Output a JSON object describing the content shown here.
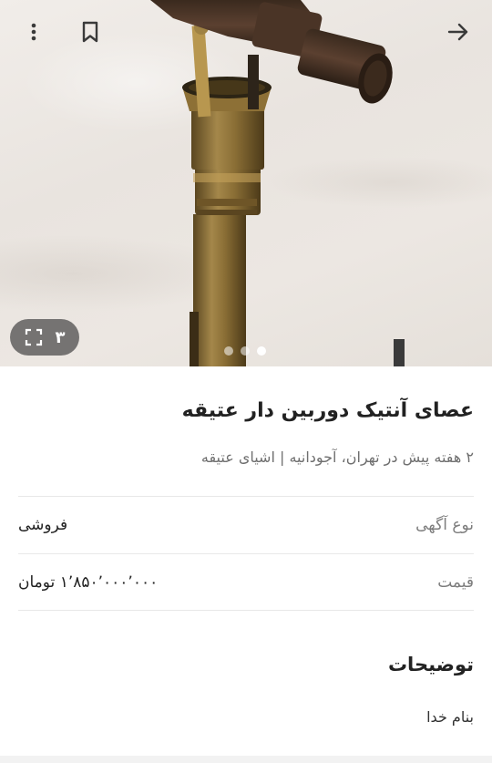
{
  "gallery": {
    "image_alt": "antique telescope cane photo",
    "count_label": "۳",
    "page_count": 3,
    "active_page": 3
  },
  "header_icons": {
    "more": "more-vertical-icon",
    "bookmark": "bookmark-icon",
    "forward": "arrow-right-icon",
    "expand": "expand-icon"
  },
  "ad": {
    "title": "عصای آنتیک دوربین دار عتیقه",
    "subtitle": "۲ هفته پیش در تهران، آجودانیه | اشیای عتیقه"
  },
  "details": [
    {
      "label": "نوع آگهی",
      "value": "فروشی"
    },
    {
      "label": "قیمت",
      "value": "۱٬۸۵۰٬۰۰۰٬۰۰۰ تومان"
    }
  ],
  "description": {
    "heading": "توضیحات",
    "text": "بنام خدا"
  },
  "colors": {
    "text_primary": "#222222",
    "text_secondary": "#7d7d7d",
    "divider": "#e8e8e8",
    "badge_bg": "#464646"
  }
}
